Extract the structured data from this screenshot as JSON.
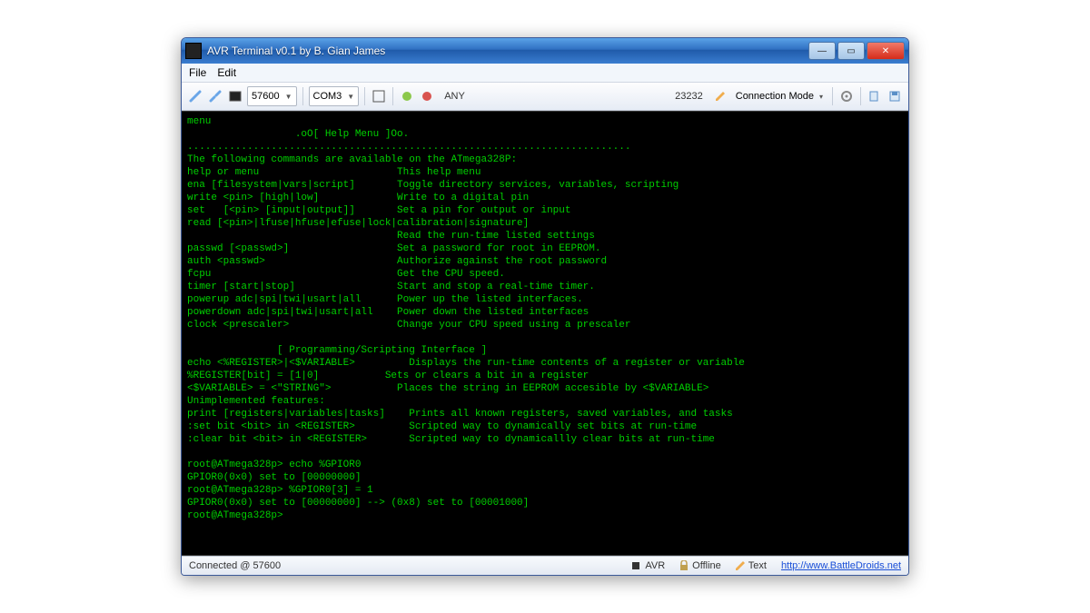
{
  "window": {
    "title": "AVR Terminal v0.1 by B. Gian James"
  },
  "menu": {
    "file": "File",
    "edit": "Edit"
  },
  "toolbar": {
    "baud": "57600",
    "port": "COM3",
    "any": "ANY",
    "counter": "23232",
    "conn_mode": "Connection Mode"
  },
  "terminal": {
    "content": "menu\n                  .oO[ Help Menu ]Oo.\n..........................................................................\nThe following commands are available on the ATmega328P:\nhelp or menu                       This help menu\nena [filesystem|vars|script]       Toggle directory services, variables, scripting\nwrite <pin> [high|low]             Write to a digital pin\nset   [<pin> [input|output]]       Set a pin for output or input\nread [<pin>|lfuse|hfuse|efuse|lock|calibration|signature]\n                                   Read the run-time listed settings\npasswd [<passwd>]                  Set a password for root in EEPROM.\nauth <passwd>                      Authorize against the root password\nfcpu                               Get the CPU speed.\ntimer [start|stop]                 Start and stop a real-time timer.\npowerup adc|spi|twi|usart|all      Power up the listed interfaces.\npowerdown adc|spi|twi|usart|all    Power down the listed interfaces\nclock <prescaler>                  Change your CPU speed using a prescaler\n\n               [ Programming/Scripting Interface ]\necho <%REGISTER>|<$VARIABLE>         Displays the run-time contents of a register or variable\n%REGISTER[bit] = [1|0]           Sets or clears a bit in a register\n<$VARIABLE> = <\"STRING\">           Places the string in EEPROM accesible by <$VARIABLE>\nUnimplemented features:\nprint [registers|variables|tasks]    Prints all known registers, saved variables, and tasks\n:set bit <bit> in <REGISTER>         Scripted way to dynamically set bits at run-time\n:clear bit <bit> in <REGISTER>       Scripted way to dynamicallly clear bits at run-time\n\nroot@ATmega328p> echo %GPIOR0\nGPIOR0(0x0) set to [00000000]\nroot@ATmega328p> %GPIOR0[3] = 1\nGPIOR0(0x0) set to [00000000] --> (0x8) set to [00001000]\nroot@ATmega328p>"
  },
  "status": {
    "connected": "Connected @ 57600",
    "avr": "AVR",
    "offline": "Offline",
    "text": "Text",
    "url": "http://www.BattleDroids.net"
  }
}
